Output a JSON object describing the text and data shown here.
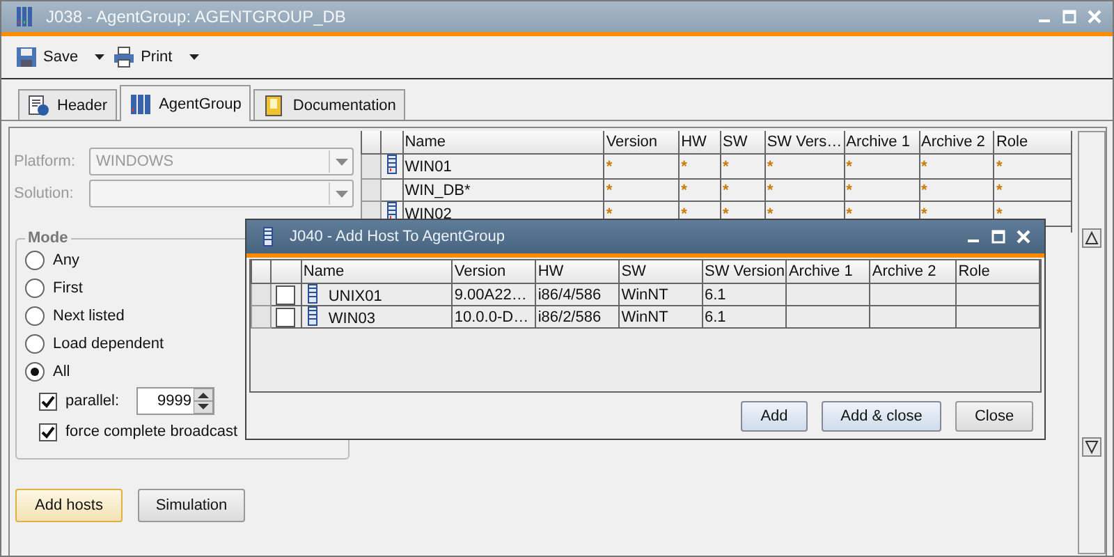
{
  "window": {
    "title": "J038 - AgentGroup: AGENTGROUP_DB"
  },
  "toolbar": [
    {
      "label": "Save",
      "kind": "save"
    },
    {
      "label": "Print",
      "kind": "print"
    }
  ],
  "tabs": [
    {
      "label": "Header",
      "kind": "header",
      "selected": false
    },
    {
      "label": "AgentGroup",
      "kind": "group",
      "selected": true
    },
    {
      "label": "Documentation",
      "kind": "doc",
      "selected": false
    }
  ],
  "fields": [
    {
      "label": "Platform:",
      "value": "WINDOWS",
      "disabled": true
    },
    {
      "label": "Solution:",
      "disabled": true
    }
  ],
  "mode": {
    "title": "Mode",
    "options": [
      {
        "label": "Any",
        "selected": false
      },
      {
        "label": "First",
        "selected": false
      },
      {
        "label": "Next listed",
        "selected": false
      },
      {
        "label": "Load dependent",
        "selected": false
      },
      {
        "label": "All",
        "selected": true
      }
    ],
    "parallel": {
      "label": "parallel:",
      "checked": true,
      "value": "9999"
    },
    "broadcast": {
      "label": "force complete broadcast",
      "checked": true
    }
  },
  "buttons": [
    {
      "label": "Add hosts",
      "focused": true
    },
    {
      "label": "Simulation",
      "focused": false
    }
  ],
  "table": {
    "columns": [
      "Name",
      "Version",
      "HW",
      "SW",
      "SW Vers…",
      "Archive 1",
      "Archive 2",
      "Role"
    ],
    "rows": [
      {
        "icon": true,
        "cells": [
          "WIN01",
          "*",
          "*",
          "*",
          "*",
          "*",
          "*",
          "*"
        ]
      },
      {
        "icon": false,
        "cells": [
          "WIN_DB*",
          "*",
          "*",
          "*",
          "*",
          "*",
          "*",
          "*"
        ]
      },
      {
        "icon": true,
        "cells": [
          "WIN02",
          "*",
          "*",
          "*",
          "*",
          "*",
          "*",
          "*"
        ]
      }
    ]
  },
  "dialog": {
    "title": "J040 - Add Host To AgentGroup",
    "columns": [
      "Name",
      "Version",
      "HW",
      "SW",
      "SW Version",
      "Archive 1",
      "Archive 2",
      "Role"
    ],
    "rows": [
      {
        "checked": false,
        "cells": [
          "UNIX01",
          "9.00A22…",
          "i86/4/586",
          "WinNT",
          "6.1"
        ]
      },
      {
        "checked": false,
        "cells": [
          "WIN03",
          "10.0.0-D…",
          "i86/2/586",
          "WinNT",
          "6.1"
        ]
      }
    ],
    "buttons": [
      {
        "label": "Add",
        "highlighted": true
      },
      {
        "label": "Add & close",
        "highlighted": true
      },
      {
        "label": "Close",
        "highlighted": false
      }
    ]
  }
}
